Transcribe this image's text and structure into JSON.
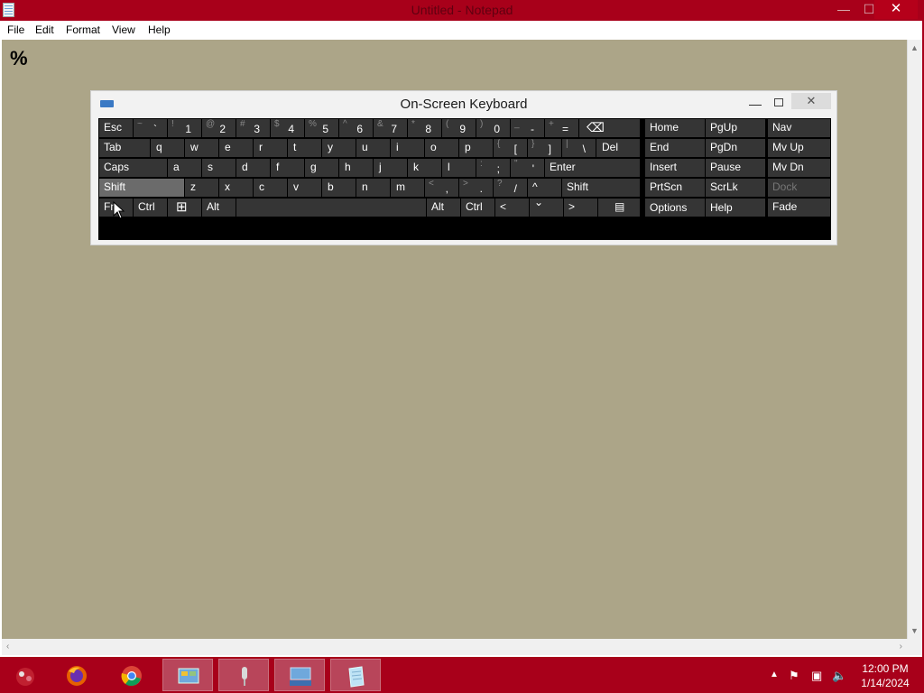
{
  "notepad": {
    "title": "Untitled - Notepad",
    "minimize_glyph": "—",
    "maximize_glyph": "☐",
    "close_glyph": "✕",
    "menu": [
      "File",
      "Edit",
      "Format",
      "View",
      "Help"
    ],
    "content": "%"
  },
  "osk": {
    "title": "On-Screen Keyboard",
    "close_glyph": "✕",
    "minimize_glyph": "—",
    "keys": {
      "esc": "Esc",
      "backtick": {
        "shift": "~",
        "main": "`"
      },
      "n1": {
        "shift": "!",
        "main": "1"
      },
      "n2": {
        "shift": "@",
        "main": "2"
      },
      "n3": {
        "shift": "#",
        "main": "3"
      },
      "n4": {
        "shift": "$",
        "main": "4"
      },
      "n5": {
        "shift": "%",
        "main": "5"
      },
      "n6": {
        "shift": "^",
        "main": "6"
      },
      "n7": {
        "shift": "&",
        "main": "7"
      },
      "n8": {
        "shift": "*",
        "main": "8"
      },
      "n9": {
        "shift": "(",
        "main": "9"
      },
      "n0": {
        "shift": ")",
        "main": "0"
      },
      "minus": {
        "shift": "_",
        "main": "-"
      },
      "equals": {
        "shift": "+",
        "main": "="
      },
      "backspace": "⌫",
      "tab": "Tab",
      "q": "q",
      "w": "w",
      "e": "e",
      "r": "r",
      "t": "t",
      "y": "y",
      "u": "u",
      "i": "i",
      "o": "o",
      "p": "p",
      "lbracket": {
        "shift": "{",
        "main": "["
      },
      "rbracket": {
        "shift": "}",
        "main": "]"
      },
      "backslash": {
        "shift": "|",
        "main": "\\"
      },
      "del": "Del",
      "caps": "Caps",
      "a": "a",
      "s": "s",
      "d": "d",
      "f": "f",
      "g": "g",
      "h": "h",
      "j": "j",
      "k": "k",
      "l": "l",
      "semicolon": {
        "shift": ":",
        "main": ";"
      },
      "quote": {
        "shift": "\"",
        "main": "'"
      },
      "enter": "Enter",
      "shift_left": "Shift",
      "z": "z",
      "x": "x",
      "c": "c",
      "v": "v",
      "b": "b",
      "n": "n",
      "m": "m",
      "comma": {
        "shift": "<",
        "main": ","
      },
      "period": {
        "shift": ">",
        "main": "."
      },
      "slash": {
        "shift": "?",
        "main": "/"
      },
      "up": "^",
      "shift_right": "Shift",
      "fn": "Fn",
      "ctrl_left": "Ctrl",
      "win": "⊞",
      "alt_left": "Alt",
      "alt_right": "Alt",
      "ctrl_right": "Ctrl",
      "left": "<",
      "down": "⌄",
      "right": ">",
      "menu": "▤",
      "home": "Home",
      "pgup": "PgUp",
      "nav": "Nav",
      "end": "End",
      "pgdn": "PgDn",
      "mvup": "Mv Up",
      "insert": "Insert",
      "pause": "Pause",
      "mvdn": "Mv Dn",
      "prtscn": "PrtScn",
      "scrlk": "ScrLk",
      "dock": "Dock",
      "options": "Options",
      "help": "Help",
      "fade": "Fade"
    },
    "pressed_key": "Shift"
  },
  "taskbar": {
    "items": [
      "start-orb",
      "firefox",
      "chrome",
      "control-panel",
      "speech-recognition",
      "on-screen-keyboard",
      "notepad"
    ],
    "active_item": "notepad",
    "tray_icons": [
      "show-hidden-icons",
      "action-center-flag",
      "network",
      "volume-muted"
    ],
    "time": "12:00 PM",
    "date": "1/14/2024"
  },
  "colors": {
    "accent": "#a8001a",
    "editor_bg": "#aca588",
    "key_bg": "#353535"
  }
}
